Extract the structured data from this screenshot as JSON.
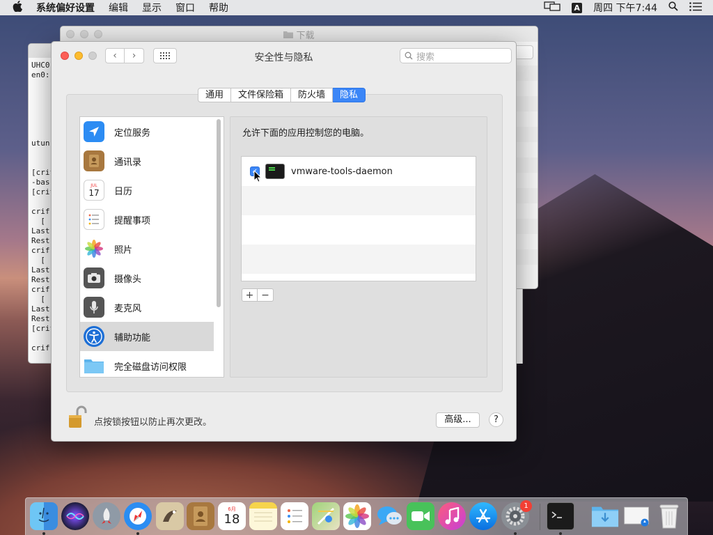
{
  "menubar": {
    "apple_icon": "apple-icon",
    "items": [
      "系统偏好设置",
      "编辑",
      "显示",
      "窗口",
      "帮助"
    ],
    "input_method": "A",
    "clock": "周四 下午7:44"
  },
  "background": {
    "terminal_lines": [
      "UHC0",
      "en0:",
      "",
      "",
      "",
      "",
      "",
      "",
      "utun",
      "",
      "",
      "[crif",
      "-bas",
      "[crif",
      "",
      "crif",
      "  [",
      "Last",
      "Rest",
      "crif",
      "  [",
      "Last",
      "Rest",
      "crif",
      "  [",
      "Last",
      "Rest",
      "[crif",
      "",
      "crif"
    ],
    "finder_title": "下载"
  },
  "window": {
    "title": "安全性与隐私",
    "search_placeholder": "搜索",
    "tabs": [
      "通用",
      "文件保险箱",
      "防火墙",
      "隐私"
    ],
    "active_tab": "隐私",
    "sidebar": [
      {
        "label": "定位服务",
        "icon": "location-arrow-icon"
      },
      {
        "label": "通讯录",
        "icon": "contacts-book-icon"
      },
      {
        "label": "日历",
        "icon": "calendar-icon"
      },
      {
        "label": "提醒事项",
        "icon": "reminders-icon"
      },
      {
        "label": "照片",
        "icon": "photos-icon"
      },
      {
        "label": "摄像头",
        "icon": "camera-icon"
      },
      {
        "label": "麦克风",
        "icon": "microphone-icon"
      },
      {
        "label": "辅助功能",
        "icon": "accessibility-icon"
      },
      {
        "label": "完全磁盘访问权限",
        "icon": "folder-icon"
      }
    ],
    "selected_sidebar": "辅助功能",
    "calendar_icon": {
      "month": "JUL",
      "day": "17"
    },
    "panel_title": "允许下面的应用控制您的电脑。",
    "apps": [
      {
        "name": "vmware-tools-daemon",
        "checked": true
      }
    ],
    "add_label": "+",
    "remove_label": "−",
    "lock_text": "点按锁按钮以防止再次更改。",
    "advanced_label": "高级...",
    "help_label": "?"
  },
  "dock": {
    "apps": [
      {
        "name": "Finder",
        "icon": "finder-icon",
        "running": true
      },
      {
        "name": "Siri",
        "icon": "siri-icon",
        "running": false
      },
      {
        "name": "Launchpad",
        "icon": "launchpad-icon",
        "running": false
      },
      {
        "name": "Safari",
        "icon": "safari-icon",
        "running": true
      },
      {
        "name": "Mail",
        "icon": "mail-icon",
        "running": false
      },
      {
        "name": "Contacts",
        "icon": "contacts-icon",
        "running": false
      },
      {
        "name": "Calendar",
        "icon": "calendar-icon",
        "running": false
      },
      {
        "name": "Notes",
        "icon": "notes-icon",
        "running": false
      },
      {
        "name": "Reminders",
        "icon": "reminders-icon",
        "running": false
      },
      {
        "name": "Maps",
        "icon": "maps-icon",
        "running": false
      },
      {
        "name": "Photos",
        "icon": "photos-icon",
        "running": false
      },
      {
        "name": "Messages",
        "icon": "messages-icon",
        "running": false
      },
      {
        "name": "FaceTime",
        "icon": "facetime-icon",
        "running": false
      },
      {
        "name": "iTunes",
        "icon": "itunes-icon",
        "running": false
      },
      {
        "name": "App Store",
        "icon": "app-store-icon",
        "running": false
      },
      {
        "name": "System Preferences",
        "icon": "gear-icon",
        "running": true,
        "badge": "1"
      },
      {
        "name": "Terminal",
        "icon": "terminal-icon",
        "running": true
      },
      {
        "name": "Downloads",
        "icon": "downloads-folder-icon",
        "running": false
      },
      {
        "name": "Document",
        "icon": "document-icon",
        "running": false
      },
      {
        "name": "Trash",
        "icon": "trash-icon",
        "running": false
      }
    ],
    "calendar_month": "6月",
    "calendar_day": "18"
  }
}
